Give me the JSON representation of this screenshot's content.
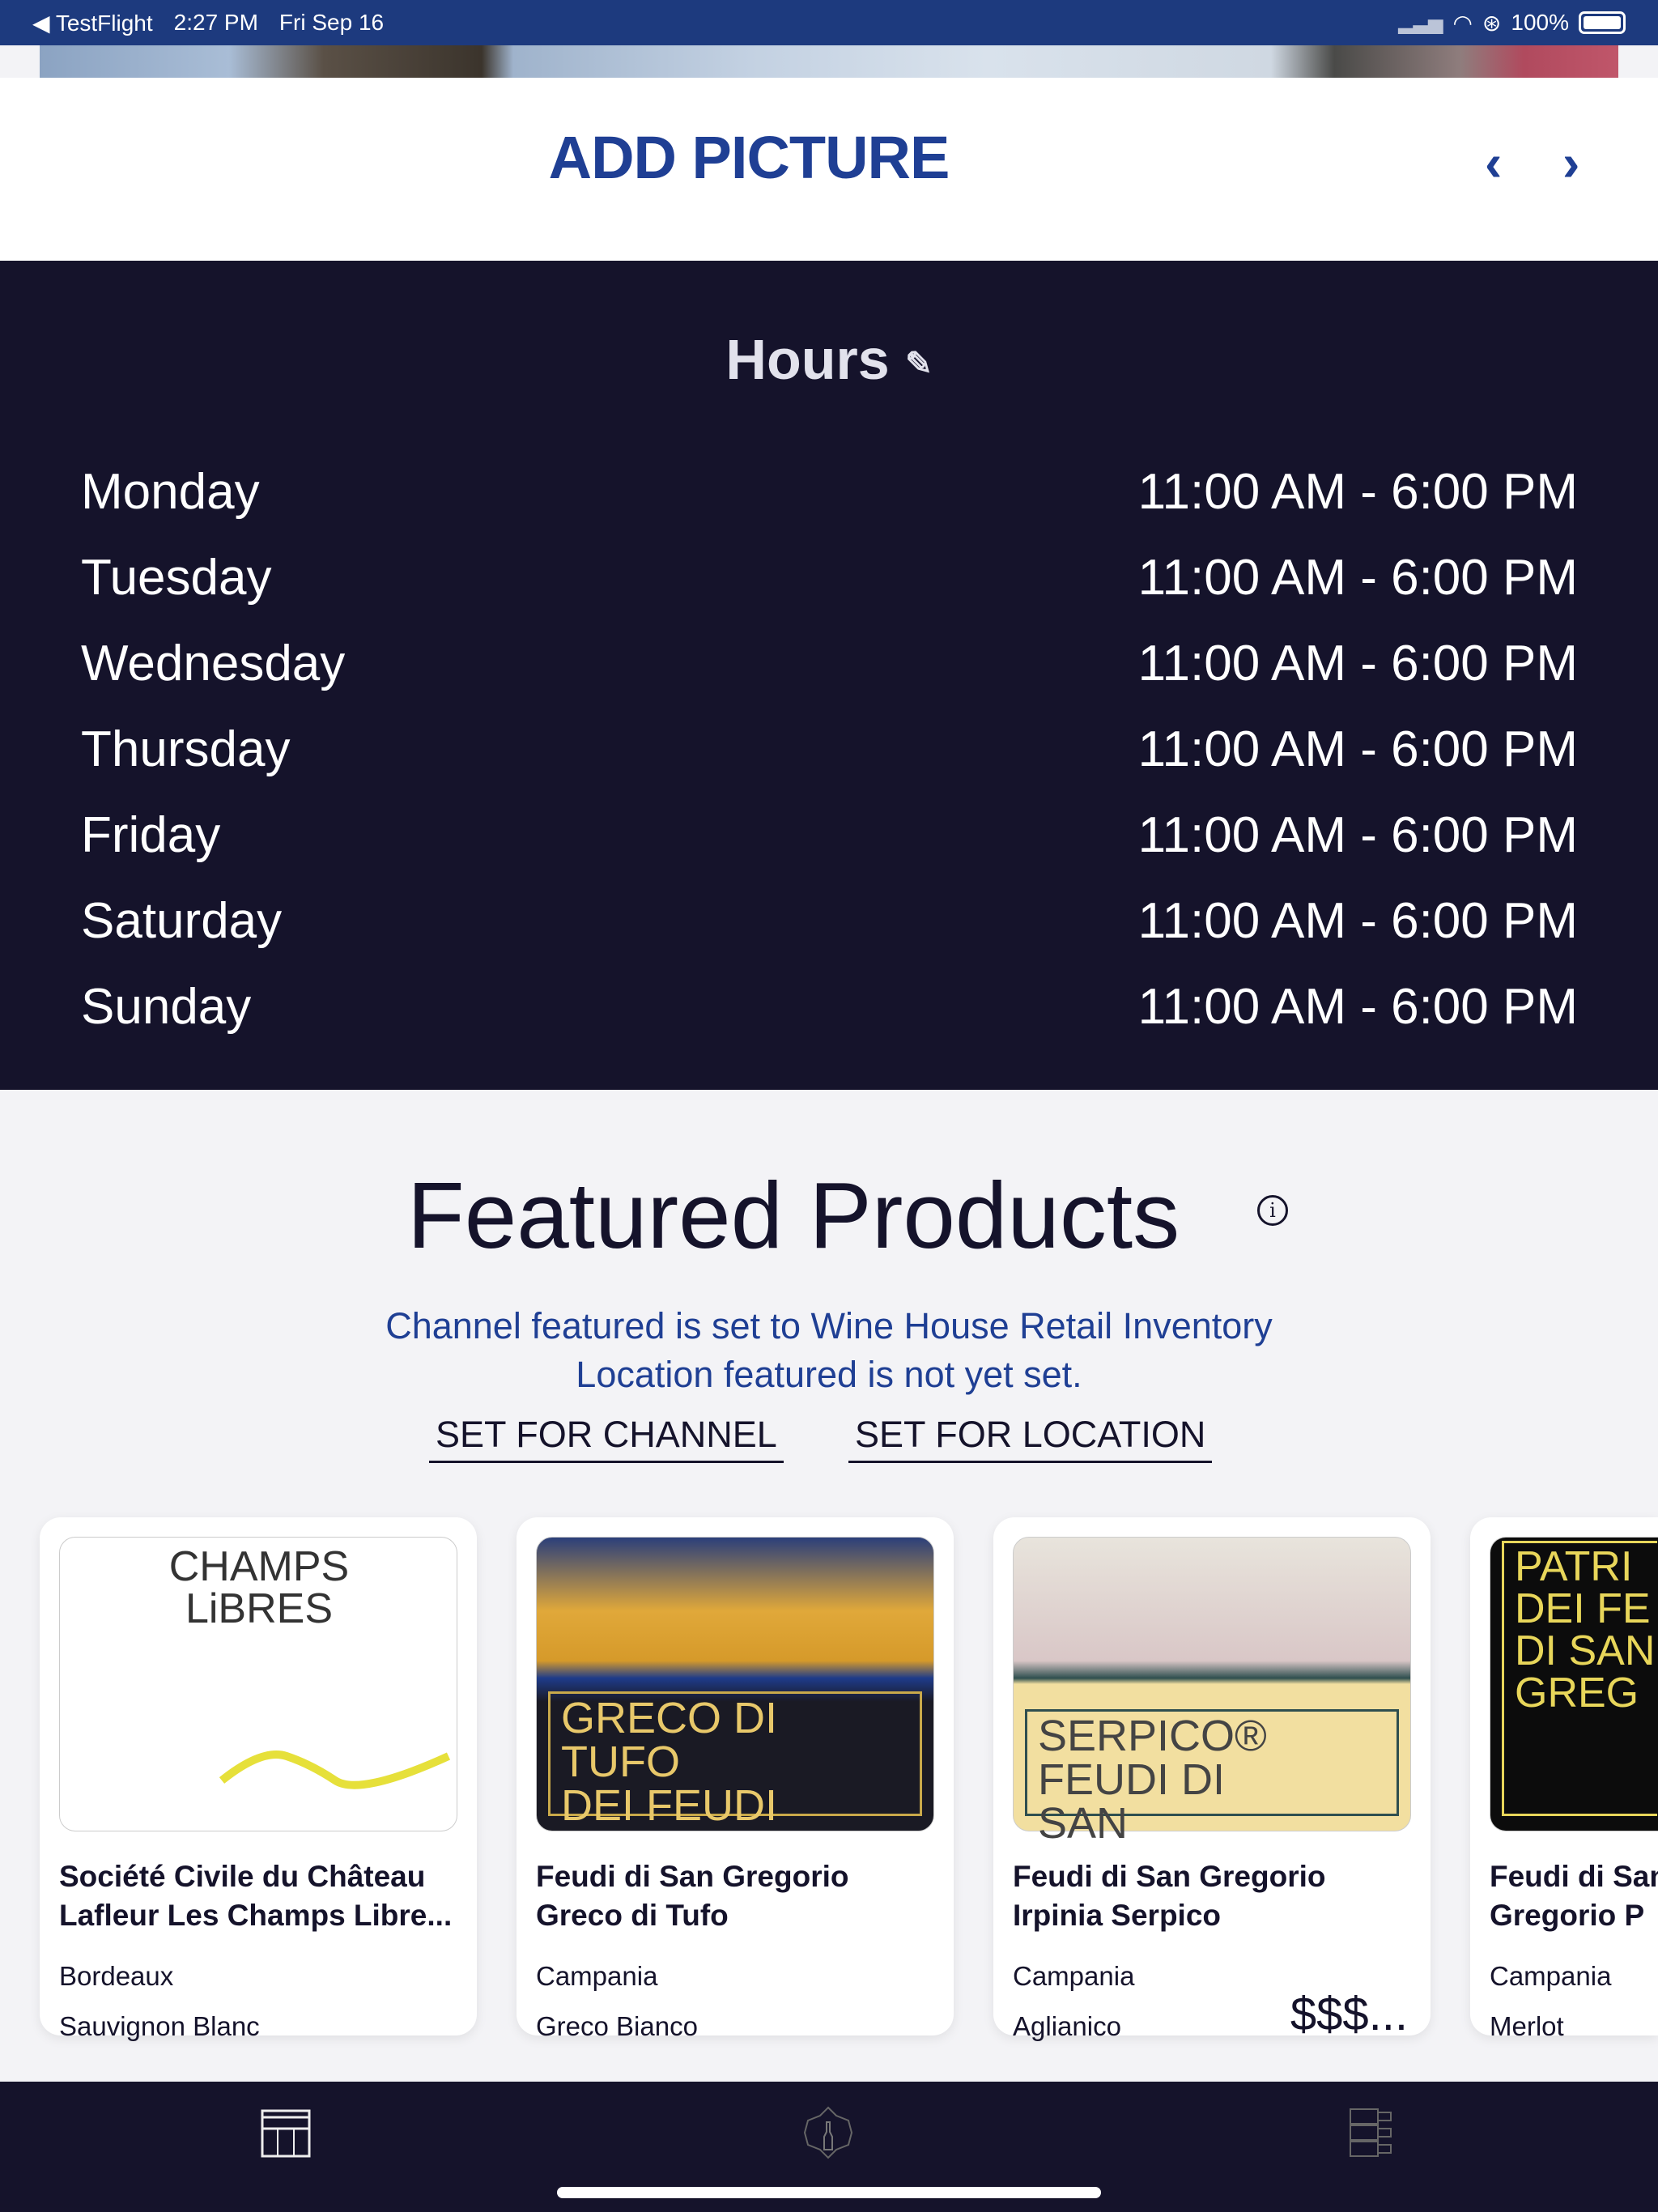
{
  "status_bar": {
    "back_app": "TestFlight",
    "time": "2:27 PM",
    "date": "Fri Sep 16",
    "battery": "100%"
  },
  "header": {
    "add_picture": "ADD PICTURE",
    "prev_icon": "chevron-left-icon",
    "next_icon": "chevron-right-icon"
  },
  "hours": {
    "title": "Hours",
    "edit_icon": "pencil-icon",
    "days": [
      {
        "day": "Monday",
        "time": "11:00 AM - 6:00 PM"
      },
      {
        "day": "Tuesday",
        "time": "11:00 AM - 6:00 PM"
      },
      {
        "day": "Wednesday",
        "time": "11:00 AM - 6:00 PM"
      },
      {
        "day": "Thursday",
        "time": "11:00 AM - 6:00 PM"
      },
      {
        "day": "Friday",
        "time": "11:00 AM - 6:00 PM"
      },
      {
        "day": "Saturday",
        "time": "11:00 AM - 6:00 PM"
      },
      {
        "day": "Sunday",
        "time": "11:00 AM - 6:00 PM"
      }
    ]
  },
  "featured": {
    "title": "Featured Products",
    "info_icon": "i",
    "channel_msg": "Channel featured is set to Wine House Retail Inventory",
    "location_msg": "Location featured is not yet set.",
    "set_channel": "SET FOR CHANNEL",
    "set_location": "SET FOR LOCATION",
    "products": [
      {
        "line1": "Société Civile du Château",
        "line2": "Lafleur Les Champs Libre...",
        "region": "Bordeaux",
        "varietal": "Sauvignon Blanc",
        "price": "",
        "label": [
          "CHAMPS",
          "LiBRES"
        ]
      },
      {
        "line1": "Feudi di San Gregorio",
        "line2": "Greco di Tufo",
        "region": "Campania",
        "varietal": "Greco Bianco",
        "price": "",
        "label": [
          "GRECO DI",
          "TUFO",
          "DEI FEUDI"
        ]
      },
      {
        "line1": "Feudi di San Gregorio",
        "line2": "Irpinia Serpico",
        "region": "Campania",
        "varietal": "Aglianico",
        "price": "$$$...",
        "label": [
          "SERPICO®",
          "FEUDI DI",
          "SAN"
        ]
      },
      {
        "line1": "Feudi di San",
        "line2": "Gregorio P",
        "region": "Campania",
        "varietal": "Merlot",
        "price": "",
        "label": [
          "PATRI",
          "DEI FE",
          "DI SAN",
          "GREG"
        ]
      }
    ]
  },
  "tabbar": {
    "items": [
      "store-icon",
      "wine-bottle-badge-icon",
      "wine-rack-icon"
    ]
  },
  "colors": {
    "status_bar": "#1d3a7e",
    "accent": "#1f3f94",
    "dark": "#15132b",
    "light_bg": "#f3f3f6"
  }
}
